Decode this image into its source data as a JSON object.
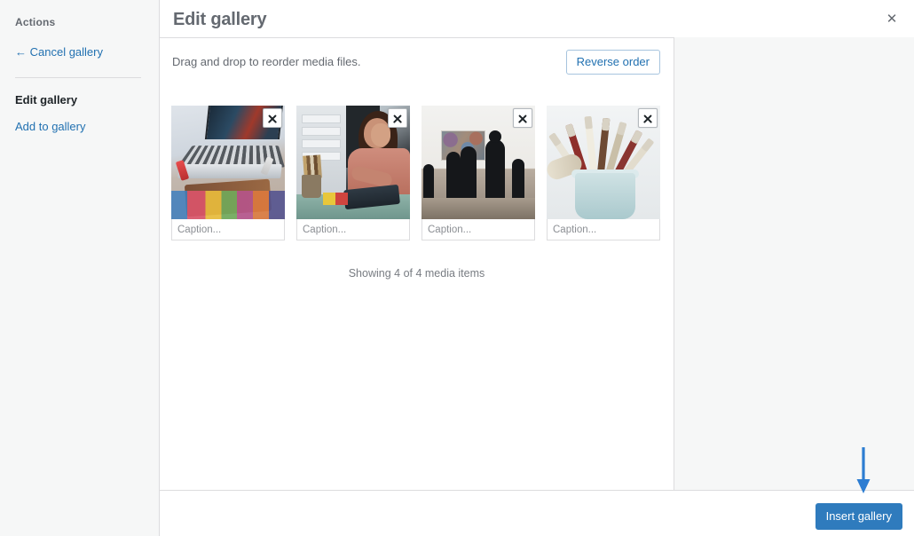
{
  "colors": {
    "accent": "#2271b1",
    "button_primary_bg": "#2f7bbd",
    "sidebar_bg": "#f6f7f7",
    "panel_bg": "#f6f7f7",
    "border": "#dcdcde",
    "annotation_arrow": "#2d7dd2",
    "heading_text": "#646970"
  },
  "sidebar": {
    "heading": "Actions",
    "cancel_link": "← Cancel gallery",
    "section_label": "Edit gallery",
    "add_link": "Add to gallery"
  },
  "header": {
    "title": "Edit gallery",
    "close_icon": "close-icon",
    "close_glyph": "✕"
  },
  "toolbar": {
    "hint": "Drag and drop to reorder media files.",
    "reverse_order_label": "Reverse order"
  },
  "attachments": [
    {
      "art": "art-laptop",
      "caption_value": "",
      "caption_placeholder": "Caption...",
      "remove_icon": "remove-icon"
    },
    {
      "art": "art-artist",
      "caption_value": "",
      "caption_placeholder": "Caption...",
      "remove_icon": "remove-icon"
    },
    {
      "art": "art-gallery",
      "caption_value": "",
      "caption_placeholder": "Caption...",
      "remove_icon": "remove-icon"
    },
    {
      "art": "art-brushes",
      "caption_value": "",
      "caption_placeholder": "Caption...",
      "remove_icon": "remove-icon"
    }
  ],
  "status": {
    "showing_count": "Showing 4 of 4 media items"
  },
  "footer": {
    "insert_label": "Insert gallery"
  },
  "annotation": {
    "arrow_icon": "down-arrow-annotation-icon"
  }
}
